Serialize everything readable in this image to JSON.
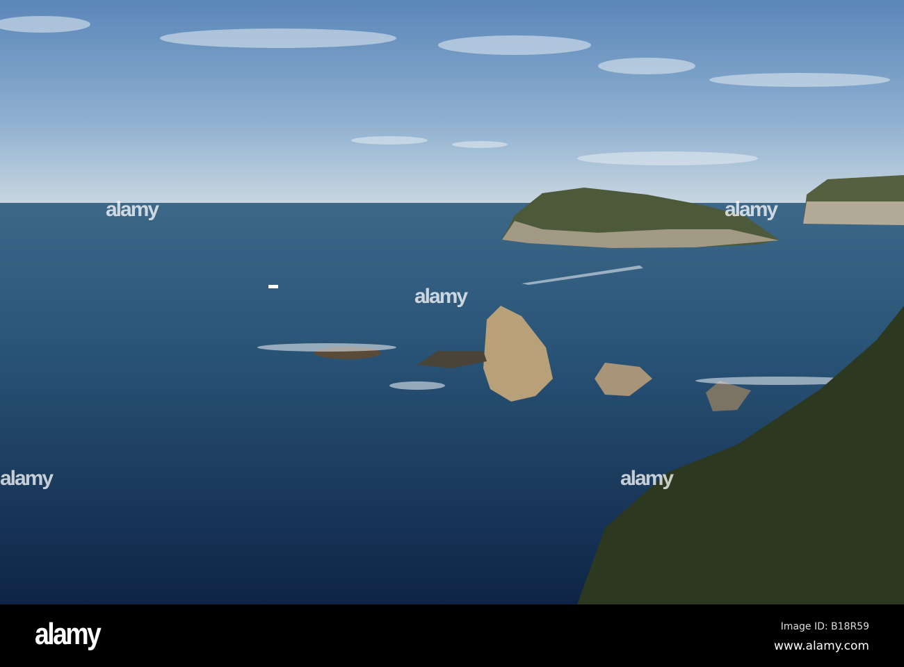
{
  "footer": {
    "logo": "alamy",
    "image_id": "Image ID: B18R59",
    "url": "www.alamy.com"
  },
  "watermark": "alamy"
}
